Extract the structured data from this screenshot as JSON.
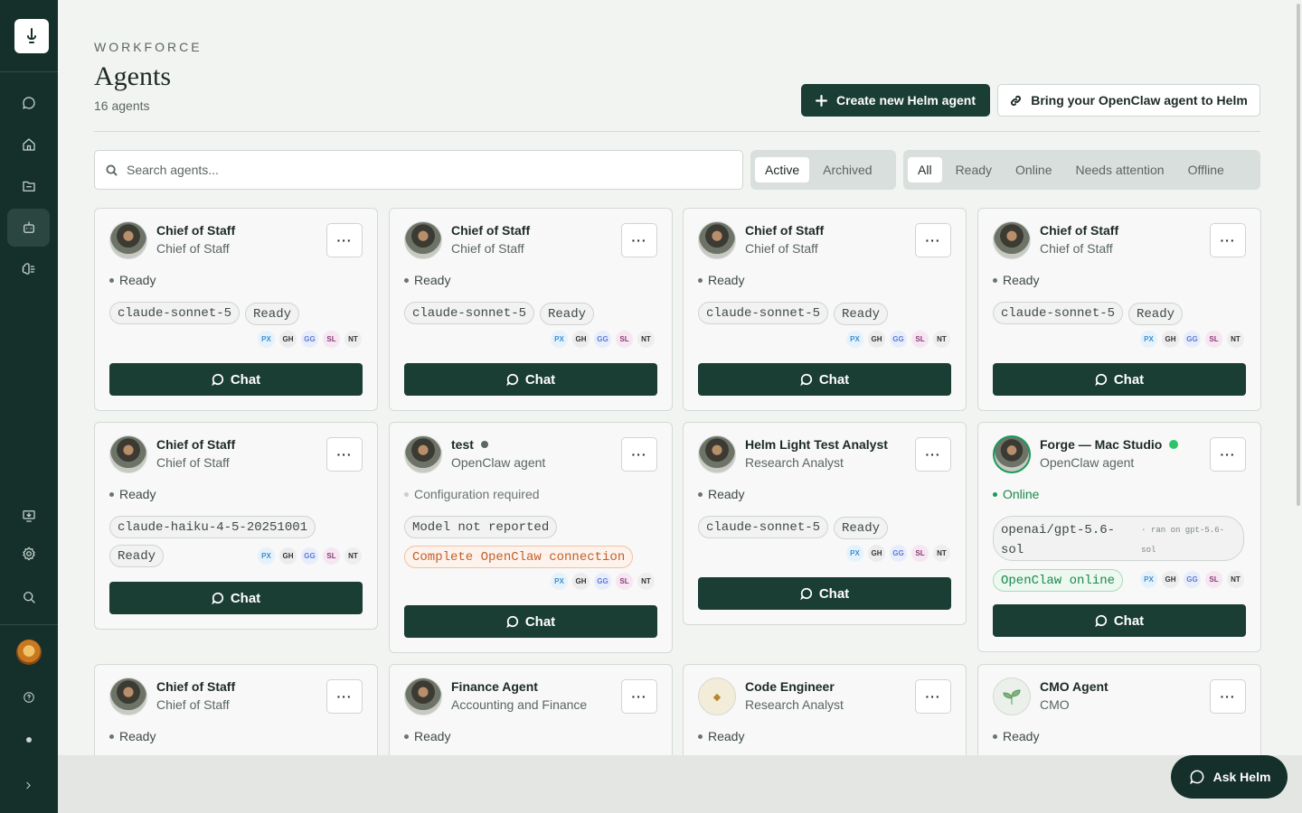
{
  "sidebar": {
    "logo_icon": "helm-anchor-icon",
    "nav": [
      "chat-icon",
      "home-icon",
      "folder-icon",
      "agents-bot-icon",
      "brain-icon"
    ],
    "bottom": [
      "monitor-icon",
      "gear-icon",
      "search-icon",
      "help-icon",
      "expand-chevron-icon"
    ]
  },
  "header": {
    "eyebrow": "WORKFORCE",
    "title": "Agents",
    "count": "16 agents",
    "create_label": "Create new Helm agent",
    "bring_label": "Bring your OpenClaw agent to Helm"
  },
  "toolbar": {
    "search_placeholder": "Search agents...",
    "scope_tabs": [
      "Active",
      "Archived"
    ],
    "scope_selected": "Active",
    "status_tabs": [
      "All",
      "Ready",
      "Online",
      "Needs attention",
      "Offline"
    ],
    "status_selected": "All"
  },
  "badges": [
    "PX",
    "GH",
    "GG",
    "SL",
    "NT"
  ],
  "menu_label": "···",
  "chat_label": "Chat",
  "cards": [
    {
      "name": "Chief of Staff",
      "role": "Chief of Staff",
      "status": "Ready",
      "model": "claude-sonnet-5",
      "state": "Ready"
    },
    {
      "name": "Chief of Staff",
      "role": "Chief of Staff",
      "status": "Ready",
      "model": "claude-sonnet-5",
      "state": "Ready"
    },
    {
      "name": "Chief of Staff",
      "role": "Chief of Staff",
      "status": "Ready",
      "model": "claude-sonnet-5",
      "state": "Ready"
    },
    {
      "name": "Chief of Staff",
      "role": "Chief of Staff",
      "status": "Ready",
      "model": "claude-sonnet-5",
      "state": "Ready"
    },
    {
      "name": "Chief of Staff",
      "role": "Chief of Staff",
      "status": "Ready",
      "model": "claude-haiku-4-5-20251001",
      "state": "Ready"
    },
    {
      "name": "test",
      "role": "OpenClaw agent",
      "status": "Configuration required",
      "model": "Model not reported",
      "state": "Complete OpenClaw connection"
    },
    {
      "name": "Helm Light Test Analyst",
      "role": "Research Analyst",
      "status": "Ready",
      "model": "claude-sonnet-5",
      "state": "Ready"
    },
    {
      "name": "Forge — Mac Studio",
      "role": "OpenClaw agent",
      "status": "Online",
      "model": "openai/gpt-5.6-sol",
      "model_note": "· ran on gpt-5.6-sol",
      "state": "OpenClaw online"
    },
    {
      "name": "Chief of Staff",
      "role": "Chief of Staff",
      "status": "Ready"
    },
    {
      "name": "Finance Agent",
      "role": "Accounting and Finance",
      "status": "Ready"
    },
    {
      "name": "Code Engineer",
      "role": "Research Analyst",
      "status": "Ready"
    },
    {
      "name": "CMO Agent",
      "role": "CMO",
      "status": "Ready"
    }
  ],
  "colors": {
    "primary": "#1a3d34",
    "online": "#1a9a5a",
    "warning": "#c0602c"
  },
  "ask_helm": "Ask Helm"
}
